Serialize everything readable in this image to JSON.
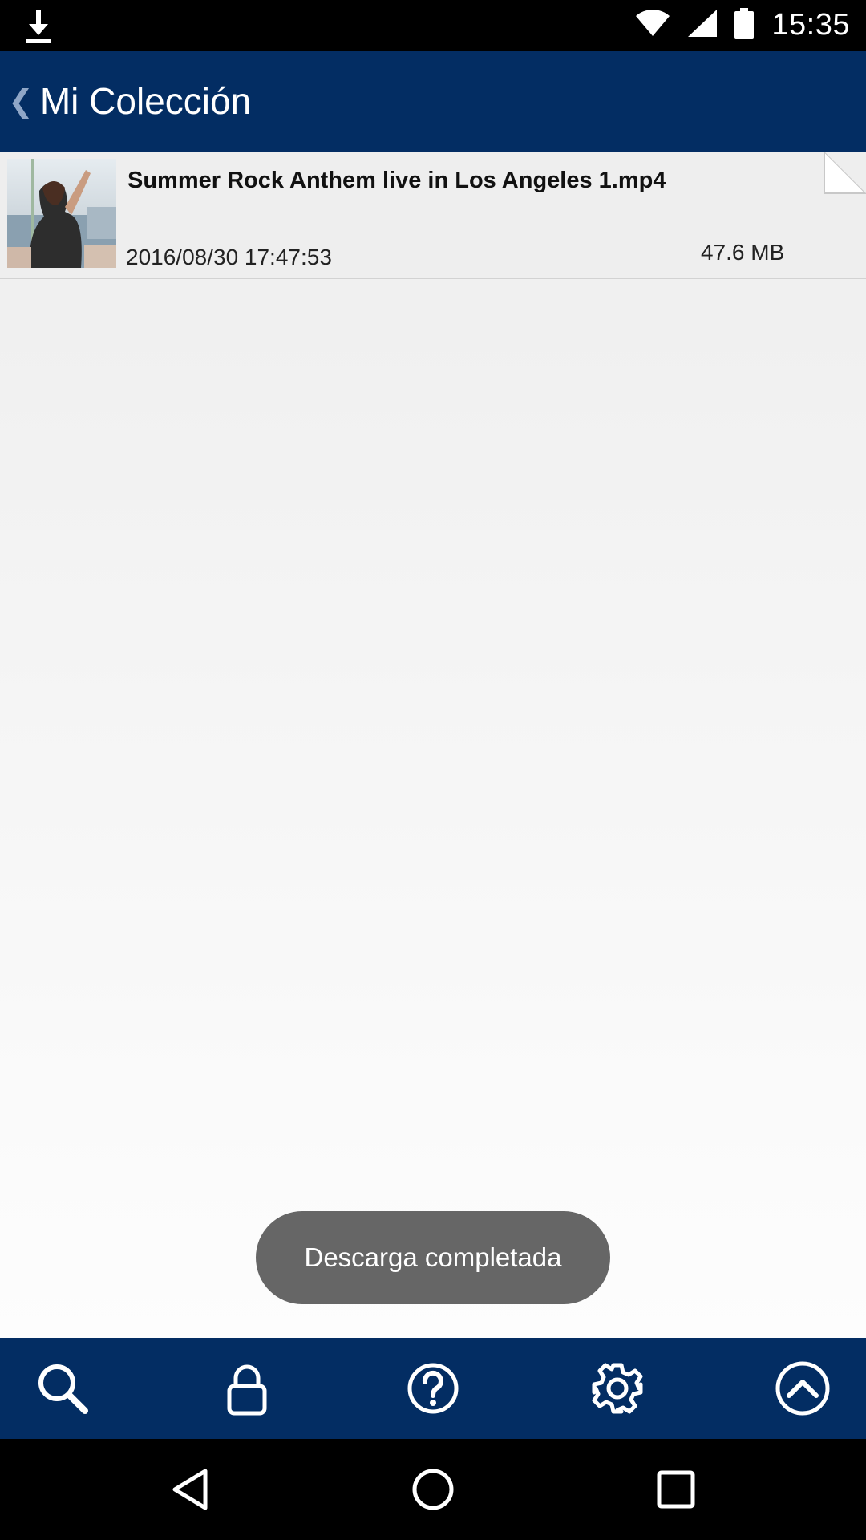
{
  "status_bar": {
    "time": "15:35",
    "icons": [
      "download-icon",
      "wifi-icon",
      "signal-icon",
      "battery-icon"
    ]
  },
  "app_bar": {
    "back_glyph": "❮",
    "title": "Mi Colección"
  },
  "files": [
    {
      "name": "Summer Rock Anthem live in Los Angeles 1.mp4",
      "date": "2016/08/30 17:47:53",
      "size": "47.6 MB"
    }
  ],
  "toast": {
    "message": "Descarga completada"
  },
  "toolbar": {
    "items": [
      "search-icon",
      "lock-icon",
      "help-icon",
      "settings-icon",
      "scroll-up-icon"
    ]
  },
  "colors": {
    "app_bar": "#032d63",
    "toolbar": "#032d63",
    "toast": "#666666"
  }
}
